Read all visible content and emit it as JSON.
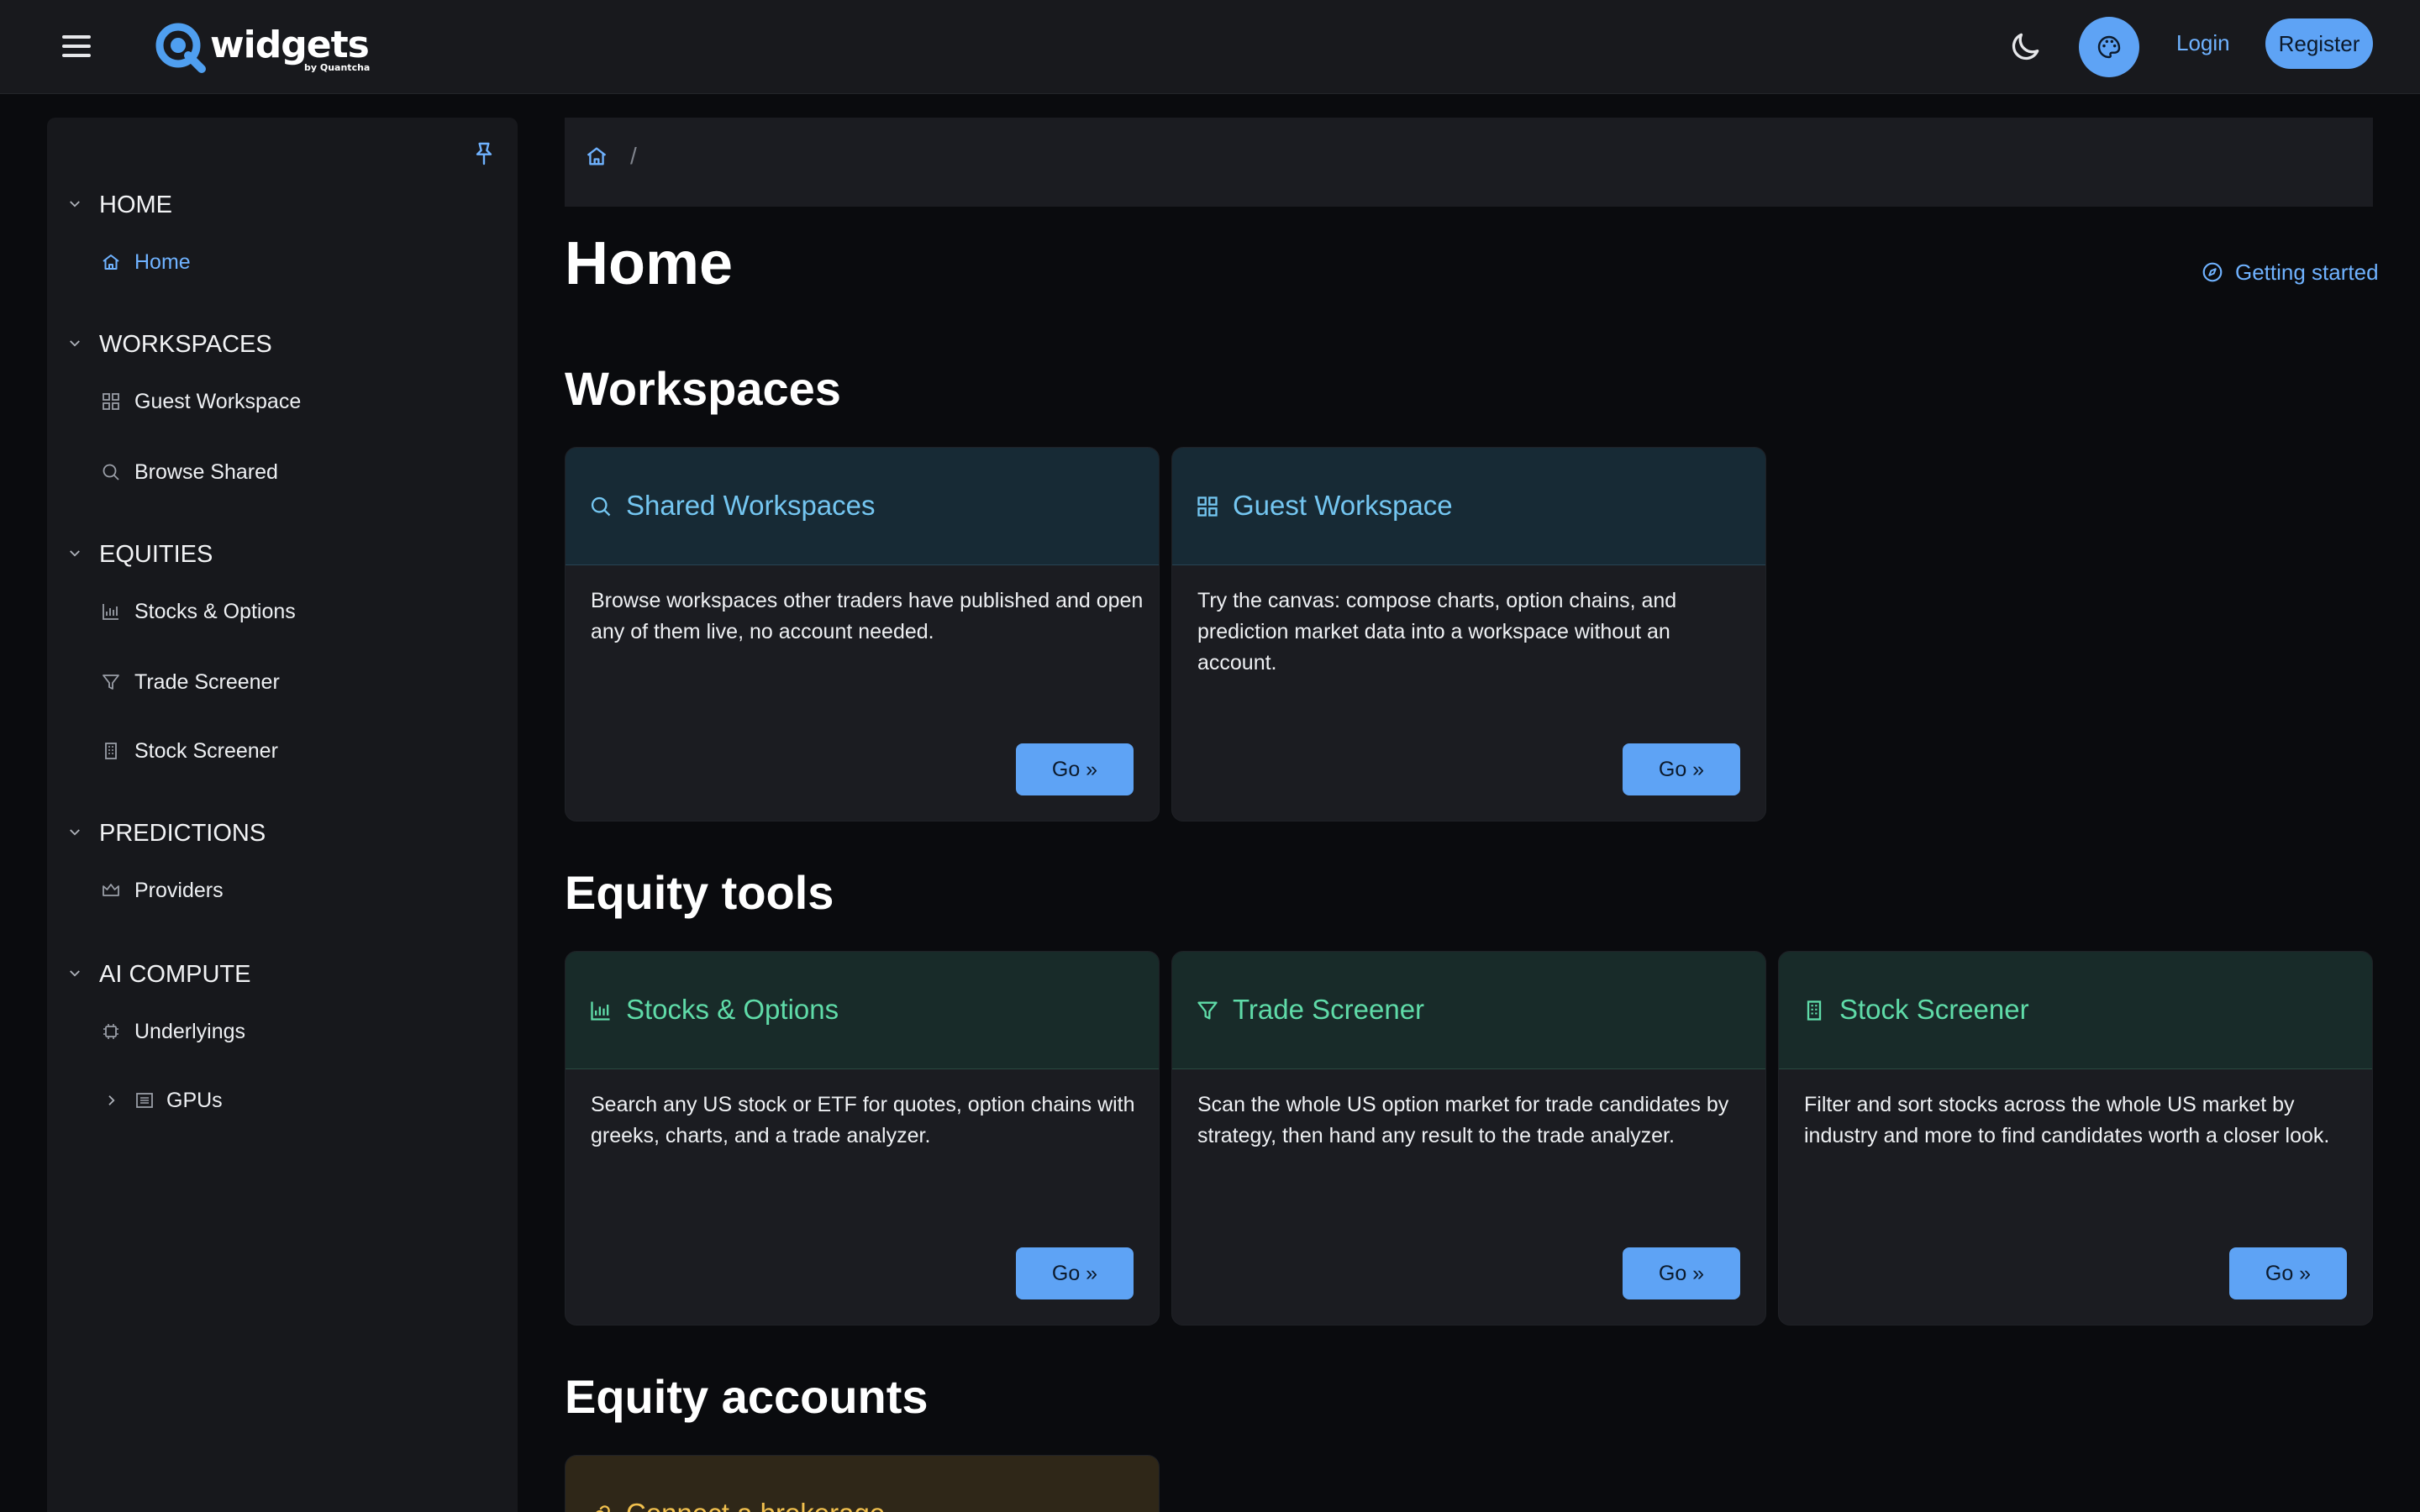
{
  "header": {
    "logo_text": "widgets",
    "logo_sub": "by Quantcha",
    "login_label": "Login",
    "register_label": "Register"
  },
  "sidebar": {
    "sections": [
      {
        "title": "HOME",
        "items": [
          {
            "label": "Home",
            "icon": "home-icon",
            "active": true
          }
        ]
      },
      {
        "title": "WORKSPACES",
        "items": [
          {
            "label": "Guest Workspace",
            "icon": "grid-icon"
          },
          {
            "label": "Browse Shared",
            "icon": "search-icon"
          }
        ]
      },
      {
        "title": "EQUITIES",
        "items": [
          {
            "label": "Stocks & Options",
            "icon": "bar-chart-icon"
          },
          {
            "label": "Trade Screener",
            "icon": "filter-icon"
          },
          {
            "label": "Stock Screener",
            "icon": "building-icon"
          }
        ]
      },
      {
        "title": "PREDICTIONS",
        "items": [
          {
            "label": "Providers",
            "icon": "crown-icon"
          }
        ]
      },
      {
        "title": "AI COMPUTE",
        "items": [
          {
            "label": "Underlyings",
            "icon": "chip-icon"
          },
          {
            "label": "GPUs",
            "icon": "server-icon"
          }
        ]
      }
    ]
  },
  "breadcrumb": {
    "separator": "/"
  },
  "main": {
    "title": "Home",
    "getting_started": "Getting started",
    "sections": [
      {
        "title": "Workspaces",
        "cards": [
          {
            "title": "Shared Workspaces",
            "icon": "search-icon",
            "body": "Browse workspaces other traders have published and open any of them live, no account needed.",
            "button": "Go »"
          },
          {
            "title": "Guest Workspace",
            "icon": "grid-icon",
            "body": "Try the canvas: compose charts, option chains, and prediction market data into a workspace without an account.",
            "button": "Go »"
          }
        ]
      },
      {
        "title": "Equity tools",
        "cards": [
          {
            "title": "Stocks & Options",
            "icon": "bar-chart-icon",
            "body": "Search any US stock or ETF for quotes, option chains with greeks, charts, and a trade analyzer.",
            "button": "Go »"
          },
          {
            "title": "Trade Screener",
            "icon": "filter-icon",
            "body": "Scan the whole US option market for trade candidates by strategy, then hand any result to the trade analyzer.",
            "button": "Go »"
          },
          {
            "title": "Stock Screener",
            "icon": "building-icon",
            "body": "Filter and sort stocks across the whole US market by industry and more to find candidates worth a closer look.",
            "button": "Go »"
          }
        ]
      },
      {
        "title": "Equity accounts",
        "cards": [
          {
            "title": "Connect a brokerage",
            "icon": "link-icon"
          }
        ]
      }
    ]
  },
  "colors": {
    "accent": "#5ea3f5",
    "link": "#6fb2ff",
    "workspace_title": "#74c6f1",
    "equity_title": "#5fdba8",
    "account_title": "#f2c14e"
  }
}
